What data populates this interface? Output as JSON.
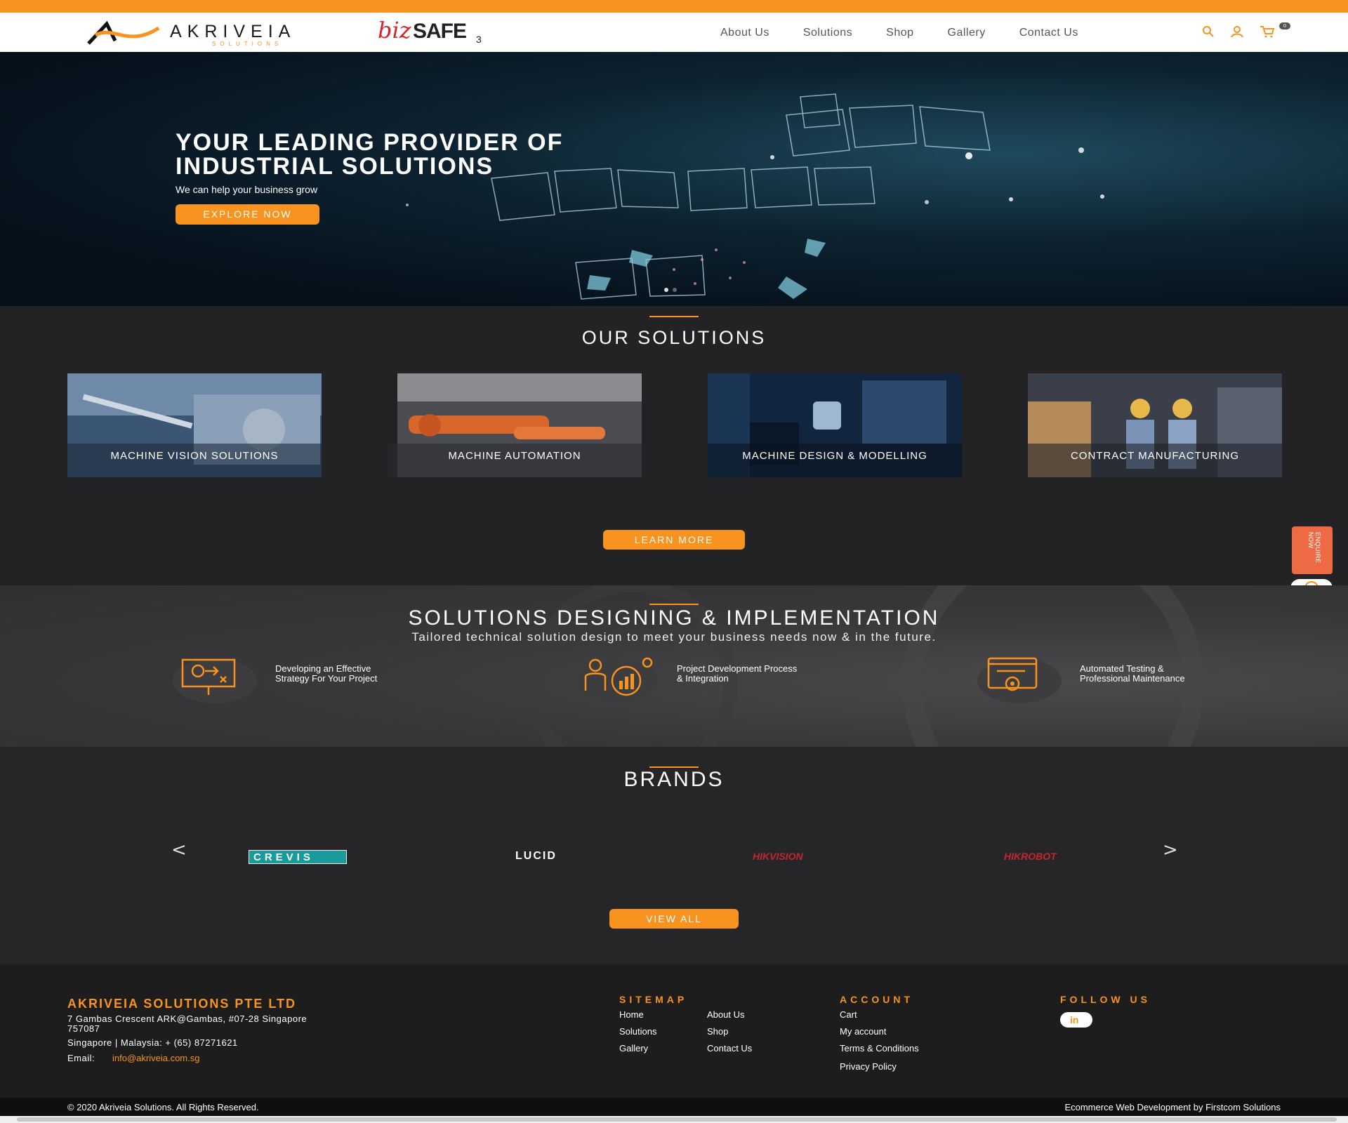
{
  "header": {
    "logo_word": "AKRIVEIA",
    "logo_sub": "SOLUTIONS",
    "bizsafe": {
      "biz": "biz",
      "safe": "SAFE",
      "level": "3"
    },
    "nav": [
      "About Us",
      "Solutions",
      "Shop",
      "Gallery",
      "Contact Us"
    ],
    "cart_count": "0",
    "icons": [
      "search-icon",
      "user-icon",
      "cart-icon"
    ]
  },
  "hero": {
    "title": "YOUR LEADING PROVIDER OF\nINDUSTRIAL SOLUTIONS",
    "subtitle": "We can help your business grow",
    "button": "EXPLORE NOW",
    "slides": 2,
    "active_slide": 1
  },
  "solutions": {
    "title": "OUR SOLUTIONS",
    "cards": [
      {
        "label": "MACHINE VISION SOLUTIONS"
      },
      {
        "label": "MACHINE AUTOMATION"
      },
      {
        "label": "MACHINE DESIGN & MODELLING"
      },
      {
        "label": "CONTRACT MANUFACTURING"
      }
    ],
    "button": "LEARN MORE"
  },
  "side": {
    "enquire": "ENQUIRE NOW",
    "whatsapp_icon": "whatsapp-icon"
  },
  "design": {
    "title": "SOLUTIONS DESIGNING & IMPLEMENTATION",
    "tagline": "Tailored technical solution design to meet your business needs now & in the future.",
    "features": [
      {
        "text": "Developing an Effective\nStrategy For Your Project",
        "icon": "strategy-board-icon"
      },
      {
        "text": "Project Development Process\n& Integration",
        "icon": "team-analytics-icon"
      },
      {
        "text": "Automated Testing &\nProfessional Maintenance",
        "icon": "maintenance-gear-icon"
      }
    ]
  },
  "brands": {
    "title": "BRANDS",
    "items": [
      "CREVIS",
      "LUCID",
      "HIKVISION",
      "HIKROBOT"
    ],
    "prev": "<",
    "next": ">",
    "button": "VIEW ALL"
  },
  "footer": {
    "company": "AKRIVEIA SOLUTIONS PTE LTD",
    "address_1": "7 Gambas Crescent ARK@Gambas, #07-28 Singapore",
    "address_2": "757087",
    "phone": "Singapore | Malaysia: + (65) 87271621",
    "email_label": "Email:",
    "email": "info@akriveia.com.sg",
    "sitemap_title": "SITEMAP",
    "sitemap": [
      "Home",
      "About Us",
      "Solutions",
      "Shop",
      "Gallery",
      "Contact Us"
    ],
    "account_title": "ACCOUNT",
    "account": [
      "Cart",
      "My account",
      "Terms & Conditions",
      "Privacy Policy"
    ],
    "follow_title": "FOLLOW US",
    "linkedin": "in"
  },
  "copyright": {
    "left": "© 2020 Akriveia Solutions. All Rights Reserved.",
    "right": "Ecommerce Web Development by Firstcom Solutions"
  },
  "colors": {
    "accent": "#f7931e",
    "enquire": "#ee6a44",
    "dark": "#232325"
  }
}
